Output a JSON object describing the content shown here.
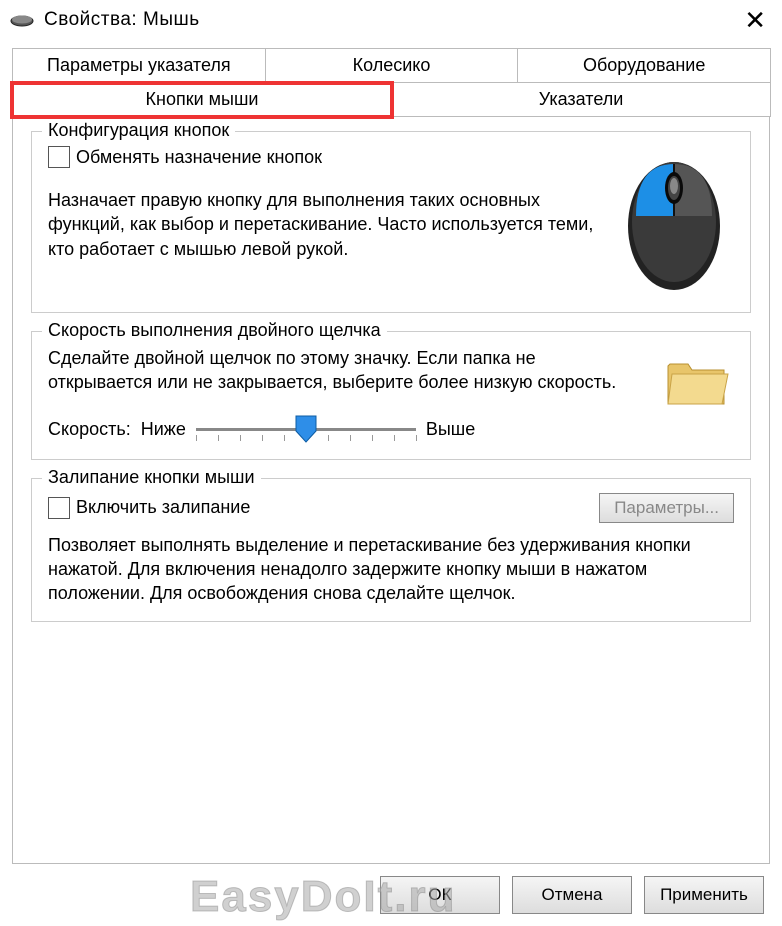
{
  "window": {
    "title": "Свойства: Мышь"
  },
  "tabs": {
    "row1": [
      {
        "label": "Параметры указателя"
      },
      {
        "label": "Колесико"
      },
      {
        "label": "Оборудование"
      }
    ],
    "row2": [
      {
        "label": "Кнопки мыши",
        "active": true
      },
      {
        "label": "Указатели"
      }
    ]
  },
  "group_buttons": {
    "legend": "Конфигурация кнопок",
    "swap_label": "Обменять назначение кнопок",
    "description": "Назначает правую кнопку для выполнения таких основных функций, как выбор и перетаскивание. Часто используется теми, кто работает с мышью левой рукой."
  },
  "group_doubleclick": {
    "legend": "Скорость выполнения двойного щелчка",
    "description": "Сделайте двойной щелчок по этому значку. Если папка не открывается или не закрывается, выберите более низкую скорость.",
    "speed_label": "Скорость:",
    "low_label": "Ниже",
    "high_label": "Выше"
  },
  "group_clicklock": {
    "legend": "Залипание кнопки мыши",
    "enable_label": "Включить залипание",
    "params_button": "Параметры...",
    "description": "Позволяет выполнять выделение и перетаскивание без удерживания кнопки нажатой. Для включения ненадолго задержите кнопку мыши в нажатом положении. Для освобождения снова сделайте щелчок."
  },
  "dialog_buttons": {
    "ok": "ОК",
    "cancel": "Отмена",
    "apply": "Применить"
  },
  "watermark": "EasyDoIt.ru"
}
